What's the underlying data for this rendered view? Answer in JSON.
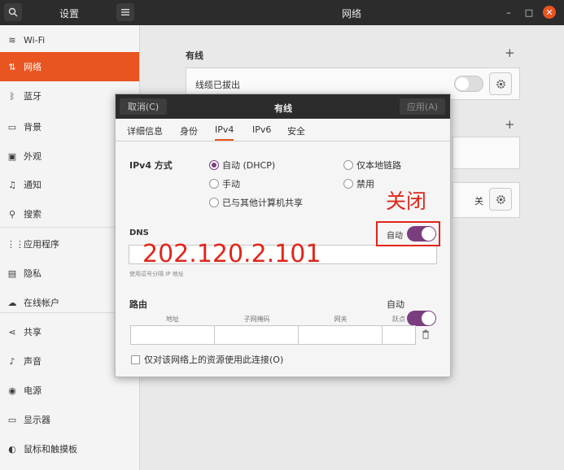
{
  "header": {
    "sidebar_title": "设置",
    "main_title": "网络",
    "icons": {
      "search": "search-icon",
      "menu": "hamburger-menu-icon"
    },
    "window_controls": {
      "minimize": "–",
      "maximize": "□",
      "close": "✕"
    }
  },
  "sidebar": {
    "items": [
      {
        "label": "Wi-Fi",
        "icon": "wifi-icon",
        "glyph": "≋"
      },
      {
        "label": "网络",
        "icon": "network-icon",
        "glyph": "⇅",
        "active": true
      },
      {
        "label": "蓝牙",
        "icon": "bluetooth-icon",
        "glyph": "ᛒ"
      },
      {
        "label": "背景",
        "icon": "background-icon",
        "glyph": "▭"
      },
      {
        "label": "外观",
        "icon": "appearance-icon",
        "glyph": "▣"
      },
      {
        "label": "通知",
        "icon": "bell-icon",
        "glyph": "♫"
      },
      {
        "label": "搜索",
        "icon": "search-icon",
        "glyph": "⚲"
      },
      {
        "label": "应用程序",
        "icon": "apps-grid-icon",
        "glyph": "⋮⋮"
      },
      {
        "label": "隐私",
        "icon": "privacy-icon",
        "glyph": "▤"
      },
      {
        "label": "在线帐户",
        "icon": "cloud-icon",
        "glyph": "☁"
      },
      {
        "label": "共享",
        "icon": "share-icon",
        "glyph": "⋖"
      },
      {
        "label": "声音",
        "icon": "music-note-icon",
        "glyph": "♪"
      },
      {
        "label": "电源",
        "icon": "power-icon",
        "glyph": "◉"
      },
      {
        "label": "显示器",
        "icon": "display-icon",
        "glyph": "▭"
      },
      {
        "label": "鼠标和触摸板",
        "icon": "mouse-icon",
        "glyph": "◐"
      }
    ]
  },
  "main": {
    "wired_title": "有线",
    "cable_status": "线缆已拔出",
    "add_symbol": "+",
    "vpn_state": "关",
    "accent_color": "#e95420"
  },
  "dialog": {
    "title": "有线",
    "cancel_label": "取消(C)",
    "apply_label": "应用(A)",
    "tabs": [
      "详细信息",
      "身份",
      "IPv4",
      "IPv6",
      "安全"
    ],
    "active_tab": "IPv4",
    "ipv4_method_label": "IPv4 方式",
    "methods": {
      "auto_dhcp": "自动 (DHCP)",
      "link_local": "仅本地链路",
      "manual": "手动",
      "disabled": "禁用",
      "shared": "已与其他计算机共享"
    },
    "selected_method": "自动 (DHCP)",
    "dns_label": "DNS",
    "dns_auto_label": "自动",
    "dns_value": "202.120.2.101",
    "dns_hint": "使用逗号分隔 IP 地址",
    "routes_label": "路由",
    "routes_auto_label": "自动",
    "route_columns": [
      "地址",
      "子网掩码",
      "网关",
      "跃点"
    ],
    "only_local_resources": "仅对该网络上的资源使用此连接(O)",
    "toggle_color": "#7a3e7e"
  },
  "annotations": {
    "off_label": "关闭",
    "color": "#e0261a"
  }
}
